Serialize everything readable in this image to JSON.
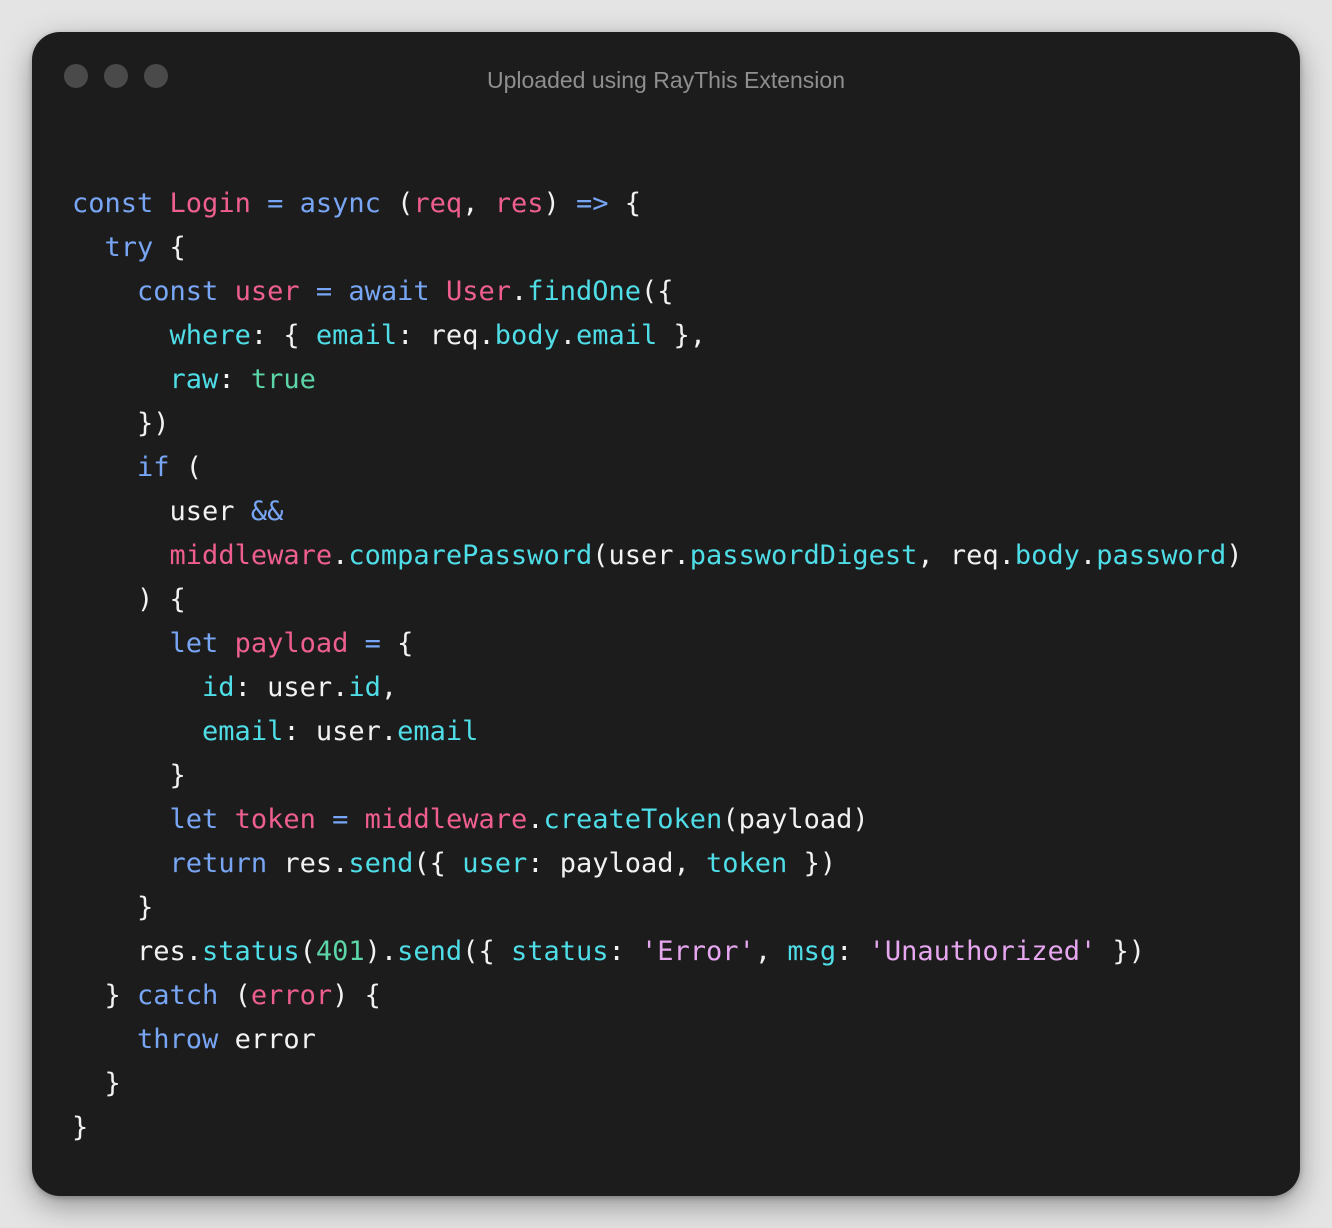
{
  "window": {
    "title": "Uploaded using RayThis Extension"
  },
  "colors": {
    "background": "#e4e4e4",
    "window": "#1c1c1c",
    "keyword": "#78a6f5",
    "name": "#ef5f8e",
    "property": "#4fdde7",
    "number": "#5cd6a8",
    "string": "#e6a7f0",
    "text": "#f2f2f2"
  },
  "code": {
    "language": "javascript",
    "lines": [
      [
        [
          "kw",
          "const"
        ],
        [
          "pl",
          " "
        ],
        [
          "nm",
          "Login"
        ],
        [
          "pl",
          " "
        ],
        [
          "op",
          "="
        ],
        [
          "pl",
          " "
        ],
        [
          "kw",
          "async"
        ],
        [
          "pl",
          " ("
        ],
        [
          "nm",
          "req"
        ],
        [
          "pl",
          ", "
        ],
        [
          "nm",
          "res"
        ],
        [
          "pl",
          ") "
        ],
        [
          "op",
          "=>"
        ],
        [
          "pl",
          " {"
        ]
      ],
      [
        [
          "pl",
          "  "
        ],
        [
          "kw",
          "try"
        ],
        [
          "pl",
          " {"
        ]
      ],
      [
        [
          "pl",
          "    "
        ],
        [
          "kw",
          "const"
        ],
        [
          "pl",
          " "
        ],
        [
          "nm",
          "user"
        ],
        [
          "pl",
          " "
        ],
        [
          "op",
          "="
        ],
        [
          "pl",
          " "
        ],
        [
          "kw",
          "await"
        ],
        [
          "pl",
          " "
        ],
        [
          "nm",
          "User"
        ],
        [
          "pl",
          "."
        ],
        [
          "pr",
          "findOne"
        ],
        [
          "pl",
          "({"
        ]
      ],
      [
        [
          "pl",
          "      "
        ],
        [
          "pr",
          "where"
        ],
        [
          "pl",
          ": { "
        ],
        [
          "pr",
          "email"
        ],
        [
          "pl",
          ": req."
        ],
        [
          "pr",
          "body"
        ],
        [
          "pl",
          "."
        ],
        [
          "pr",
          "email"
        ],
        [
          "pl",
          " },"
        ]
      ],
      [
        [
          "pl",
          "      "
        ],
        [
          "pr",
          "raw"
        ],
        [
          "pl",
          ": "
        ],
        [
          "nb",
          "true"
        ]
      ],
      [
        [
          "pl",
          "    })"
        ]
      ],
      [
        [
          "pl",
          "    "
        ],
        [
          "kw",
          "if"
        ],
        [
          "pl",
          " ("
        ]
      ],
      [
        [
          "pl",
          "      user "
        ],
        [
          "op",
          "&&"
        ]
      ],
      [
        [
          "pl",
          "      "
        ],
        [
          "nm",
          "middleware"
        ],
        [
          "pl",
          "."
        ],
        [
          "pr",
          "comparePassword"
        ],
        [
          "pl",
          "(user."
        ],
        [
          "pr",
          "passwordDigest"
        ],
        [
          "pl",
          ", req."
        ],
        [
          "pr",
          "body"
        ],
        [
          "pl",
          "."
        ],
        [
          "pr",
          "password"
        ],
        [
          "pl",
          ")"
        ]
      ],
      [
        [
          "pl",
          "    ) {"
        ]
      ],
      [
        [
          "pl",
          "      "
        ],
        [
          "kw",
          "let"
        ],
        [
          "pl",
          " "
        ],
        [
          "nm",
          "payload"
        ],
        [
          "pl",
          " "
        ],
        [
          "op",
          "="
        ],
        [
          "pl",
          " {"
        ]
      ],
      [
        [
          "pl",
          "        "
        ],
        [
          "pr",
          "id"
        ],
        [
          "pl",
          ": user."
        ],
        [
          "pr",
          "id"
        ],
        [
          "pl",
          ","
        ]
      ],
      [
        [
          "pl",
          "        "
        ],
        [
          "pr",
          "email"
        ],
        [
          "pl",
          ": user."
        ],
        [
          "pr",
          "email"
        ]
      ],
      [
        [
          "pl",
          "      }"
        ]
      ],
      [
        [
          "pl",
          "      "
        ],
        [
          "kw",
          "let"
        ],
        [
          "pl",
          " "
        ],
        [
          "nm",
          "token"
        ],
        [
          "pl",
          " "
        ],
        [
          "op",
          "="
        ],
        [
          "pl",
          " "
        ],
        [
          "nm",
          "middleware"
        ],
        [
          "pl",
          "."
        ],
        [
          "pr",
          "createToken"
        ],
        [
          "pl",
          "(payload)"
        ]
      ],
      [
        [
          "pl",
          "      "
        ],
        [
          "kw",
          "return"
        ],
        [
          "pl",
          " res."
        ],
        [
          "pr",
          "send"
        ],
        [
          "pl",
          "({ "
        ],
        [
          "pr",
          "user"
        ],
        [
          "pl",
          ": payload, "
        ],
        [
          "pr",
          "token"
        ],
        [
          "pl",
          " })"
        ]
      ],
      [
        [
          "pl",
          "    }"
        ]
      ],
      [
        [
          "pl",
          "    res."
        ],
        [
          "pr",
          "status"
        ],
        [
          "pl",
          "("
        ],
        [
          "nb",
          "401"
        ],
        [
          "pl",
          ")."
        ],
        [
          "pr",
          "send"
        ],
        [
          "pl",
          "({ "
        ],
        [
          "pr",
          "status"
        ],
        [
          "pl",
          ": "
        ],
        [
          "st",
          "'Error'"
        ],
        [
          "pl",
          ", "
        ],
        [
          "pr",
          "msg"
        ],
        [
          "pl",
          ": "
        ],
        [
          "st",
          "'Unauthorized'"
        ],
        [
          "pl",
          " })"
        ]
      ],
      [
        [
          "pl",
          "  } "
        ],
        [
          "kw",
          "catch"
        ],
        [
          "pl",
          " ("
        ],
        [
          "nm",
          "error"
        ],
        [
          "pl",
          ") {"
        ]
      ],
      [
        [
          "pl",
          "    "
        ],
        [
          "kw",
          "throw"
        ],
        [
          "pl",
          " error"
        ]
      ],
      [
        [
          "pl",
          "  }"
        ]
      ],
      [
        [
          "pl",
          "}"
        ]
      ]
    ]
  }
}
